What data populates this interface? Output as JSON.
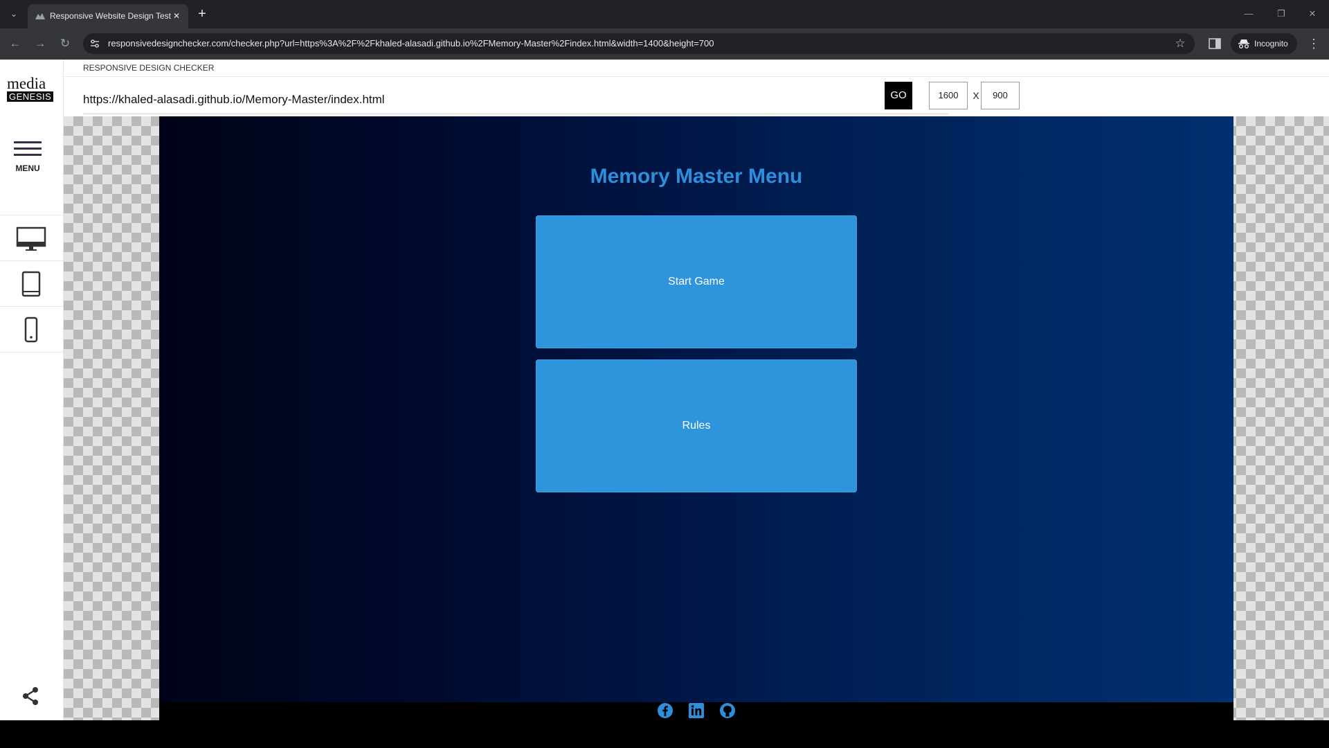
{
  "browser": {
    "tab_title": "Responsive Website Design Test",
    "tab_close": "✕",
    "new_tab": "+",
    "tab_dropdown": "⌄",
    "url": "responsivedesignchecker.com/checker.php?url=https%3A%2F%2Fkhaled-alasadi.github.io%2FMemory-Master%2Findex.html&width=1400&height=700",
    "nav": {
      "back": "←",
      "forward": "→",
      "reload": "↻"
    },
    "star": "☆",
    "incognito_label": "Incognito",
    "kebab": "⋮",
    "window_controls": {
      "minimize": "—",
      "restore": "❐",
      "close": "✕"
    }
  },
  "sidebar": {
    "logo_top": "media",
    "logo_bottom": "GENESIS",
    "menu_label": "MENU",
    "devices": [
      {
        "name": "desktop",
        "icon": "monitor-icon"
      },
      {
        "name": "tablet",
        "icon": "tablet-icon"
      },
      {
        "name": "mobile",
        "icon": "phone-icon"
      }
    ],
    "share_icon": "share-icon"
  },
  "tool": {
    "title": "RESPONSIVE DESIGN CHECKER",
    "url_value": "https://khaled-alasadi.github.io/Memory-Master/index.html",
    "go_label": "GO",
    "width": "1600",
    "x_label": "X",
    "height": "900"
  },
  "preview": {
    "title": "Memory Master Menu",
    "buttons": [
      {
        "label": "Start Game"
      },
      {
        "label": "Rules"
      }
    ],
    "social": [
      {
        "icon": "facebook-icon"
      },
      {
        "icon": "linkedin-icon"
      },
      {
        "icon": "github-icon"
      }
    ],
    "colors": {
      "accent": "#2d8fdc",
      "card": "#2e95dc"
    }
  }
}
